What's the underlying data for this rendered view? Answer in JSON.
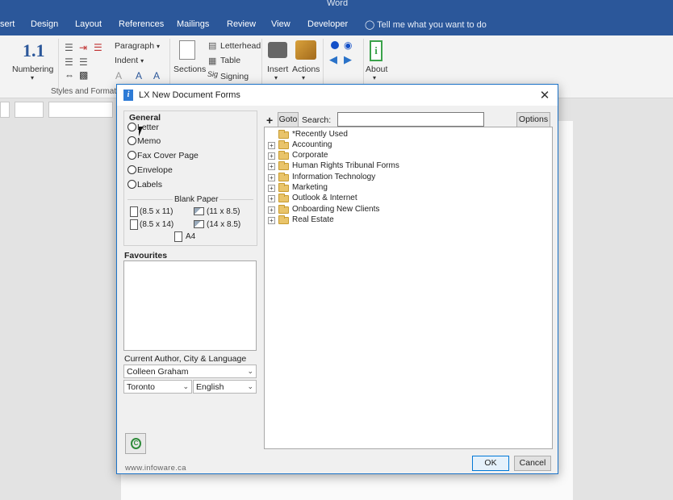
{
  "word": {
    "title": "Word",
    "tabs": [
      "sert",
      "Design",
      "Layout",
      "References",
      "Mailings",
      "Review",
      "View",
      "Developer"
    ],
    "tell_me": "Tell me what you want to do"
  },
  "ribbon": {
    "numbering": "Numbering",
    "paragraph": "Paragraph",
    "indent": "Indent",
    "styles_group": "Styles and Formatti",
    "sections": "Sections",
    "letterhead": "Letterhead",
    "table": "Table",
    "signing": "Signing",
    "insert": "Insert",
    "actions": "Actions",
    "about": "About"
  },
  "dialog": {
    "title": "LX New Document Forms",
    "general": {
      "heading": "General",
      "options": [
        "Letter",
        "Memo",
        "Fax Cover Page",
        "Envelope",
        "Labels"
      ],
      "blank_paper_heading": "Blank Paper",
      "paper_sizes": [
        "(8.5 x 11)",
        "(11 x 8.5)",
        "(8.5 x 14)",
        "(14 x 8.5)",
        "A4"
      ]
    },
    "favourites": {
      "heading": "Favourites"
    },
    "author": {
      "label": "Current Author, City & Language",
      "name": "Colleen Graham",
      "city": "Toronto",
      "language": "English"
    },
    "toolbar": {
      "add": "+",
      "goto": "Goto",
      "search_label": "Search:",
      "search_value": "",
      "options": "Options"
    },
    "tree": [
      {
        "label": "*Recently Used",
        "expandable": false
      },
      {
        "label": "Accounting",
        "expandable": true
      },
      {
        "label": "Corporate",
        "expandable": true
      },
      {
        "label": "Human Rights Tribunal Forms",
        "expandable": true
      },
      {
        "label": "Information Technology",
        "expandable": true
      },
      {
        "label": "Marketing",
        "expandable": true
      },
      {
        "label": "Outlook & Internet",
        "expandable": true
      },
      {
        "label": "Onboarding New Clients",
        "expandable": true
      },
      {
        "label": "Real Estate",
        "expandable": true
      }
    ],
    "ok": "OK",
    "cancel": "Cancel",
    "website": "www.infoware.ca",
    "colors": {
      "accent": "#0078d7",
      "title_icon": "#2e7bd6",
      "folder": "#e9c46a"
    }
  }
}
